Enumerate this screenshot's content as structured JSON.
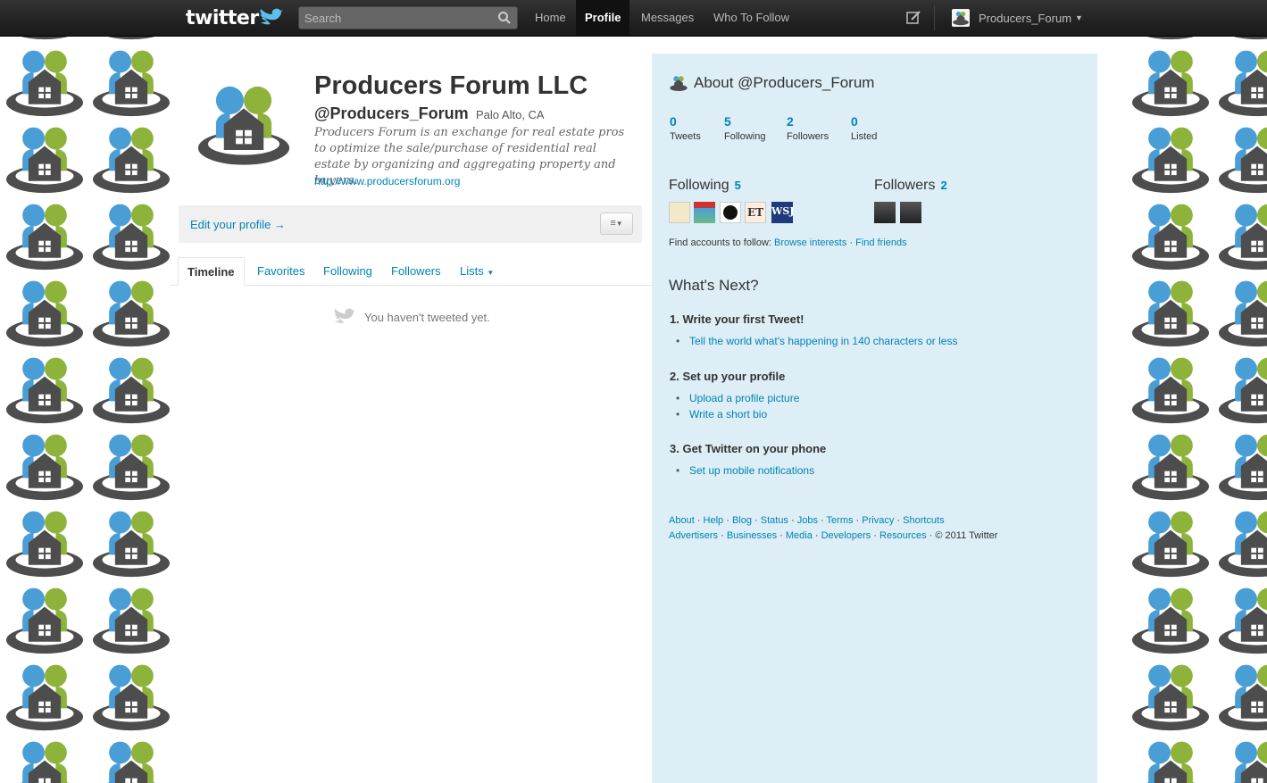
{
  "topbar": {
    "logo_text": "twitter",
    "search_placeholder": "Search",
    "nav": [
      "Home",
      "Profile",
      "Messages",
      "Who To Follow"
    ],
    "active_nav": "Profile",
    "user": "Producers_Forum"
  },
  "profile": {
    "name": "Producers Forum LLC",
    "handle": "@Producers_Forum",
    "location": "Palo Alto, CA",
    "bio": "Producers Forum is an exchange for real estate pros to optimize the sale/purchase of residential real estate by organizing and aggregating property and buyers.",
    "url": "http://www.producersforum.org",
    "edit_label": "Edit your profile →"
  },
  "tabs": [
    "Timeline",
    "Favorites",
    "Following",
    "Followers",
    "Lists"
  ],
  "empty_message": "You haven't tweeted yet.",
  "sidebar": {
    "about_title": "About @Producers_Forum",
    "stats": [
      {
        "value": "0",
        "label": "Tweets"
      },
      {
        "value": "5",
        "label": "Following"
      },
      {
        "value": "2",
        "label": "Followers"
      },
      {
        "value": "0",
        "label": "Listed"
      }
    ],
    "following": {
      "label": "Following",
      "count": "5"
    },
    "followers": {
      "label": "Followers",
      "count": "2"
    },
    "find_prefix": "Find accounts to follow: ",
    "browse_interests": "Browse interests",
    "find_friends": "Find friends",
    "whats_next": "What's Next?",
    "steps": [
      {
        "title": "1.  Write your first Tweet!",
        "links": [
          "Tell the world what's happening in 140 characters or less"
        ]
      },
      {
        "title": "2.  Set up your profile",
        "links": [
          "Upload a profile picture",
          "Write a short bio"
        ]
      },
      {
        "title": "3.  Get Twitter on your phone",
        "links": [
          "Set up mobile notifications"
        ]
      }
    ],
    "footer_row1": [
      "About",
      "Help",
      "Blog",
      "Status",
      "Jobs",
      "Terms",
      "Privacy",
      "Shortcuts"
    ],
    "footer_row2": [
      "Advertisers",
      "Businesses",
      "Media",
      "Developers",
      "Resources"
    ],
    "copyright": "© 2011 Twitter"
  },
  "colors": {
    "link": "#0084b4",
    "sidebar_bg": "#ddeef6",
    "logo_blue": "#4a9ed6",
    "logo_green": "#8db33a",
    "logo_gray": "#4d4d4d"
  }
}
